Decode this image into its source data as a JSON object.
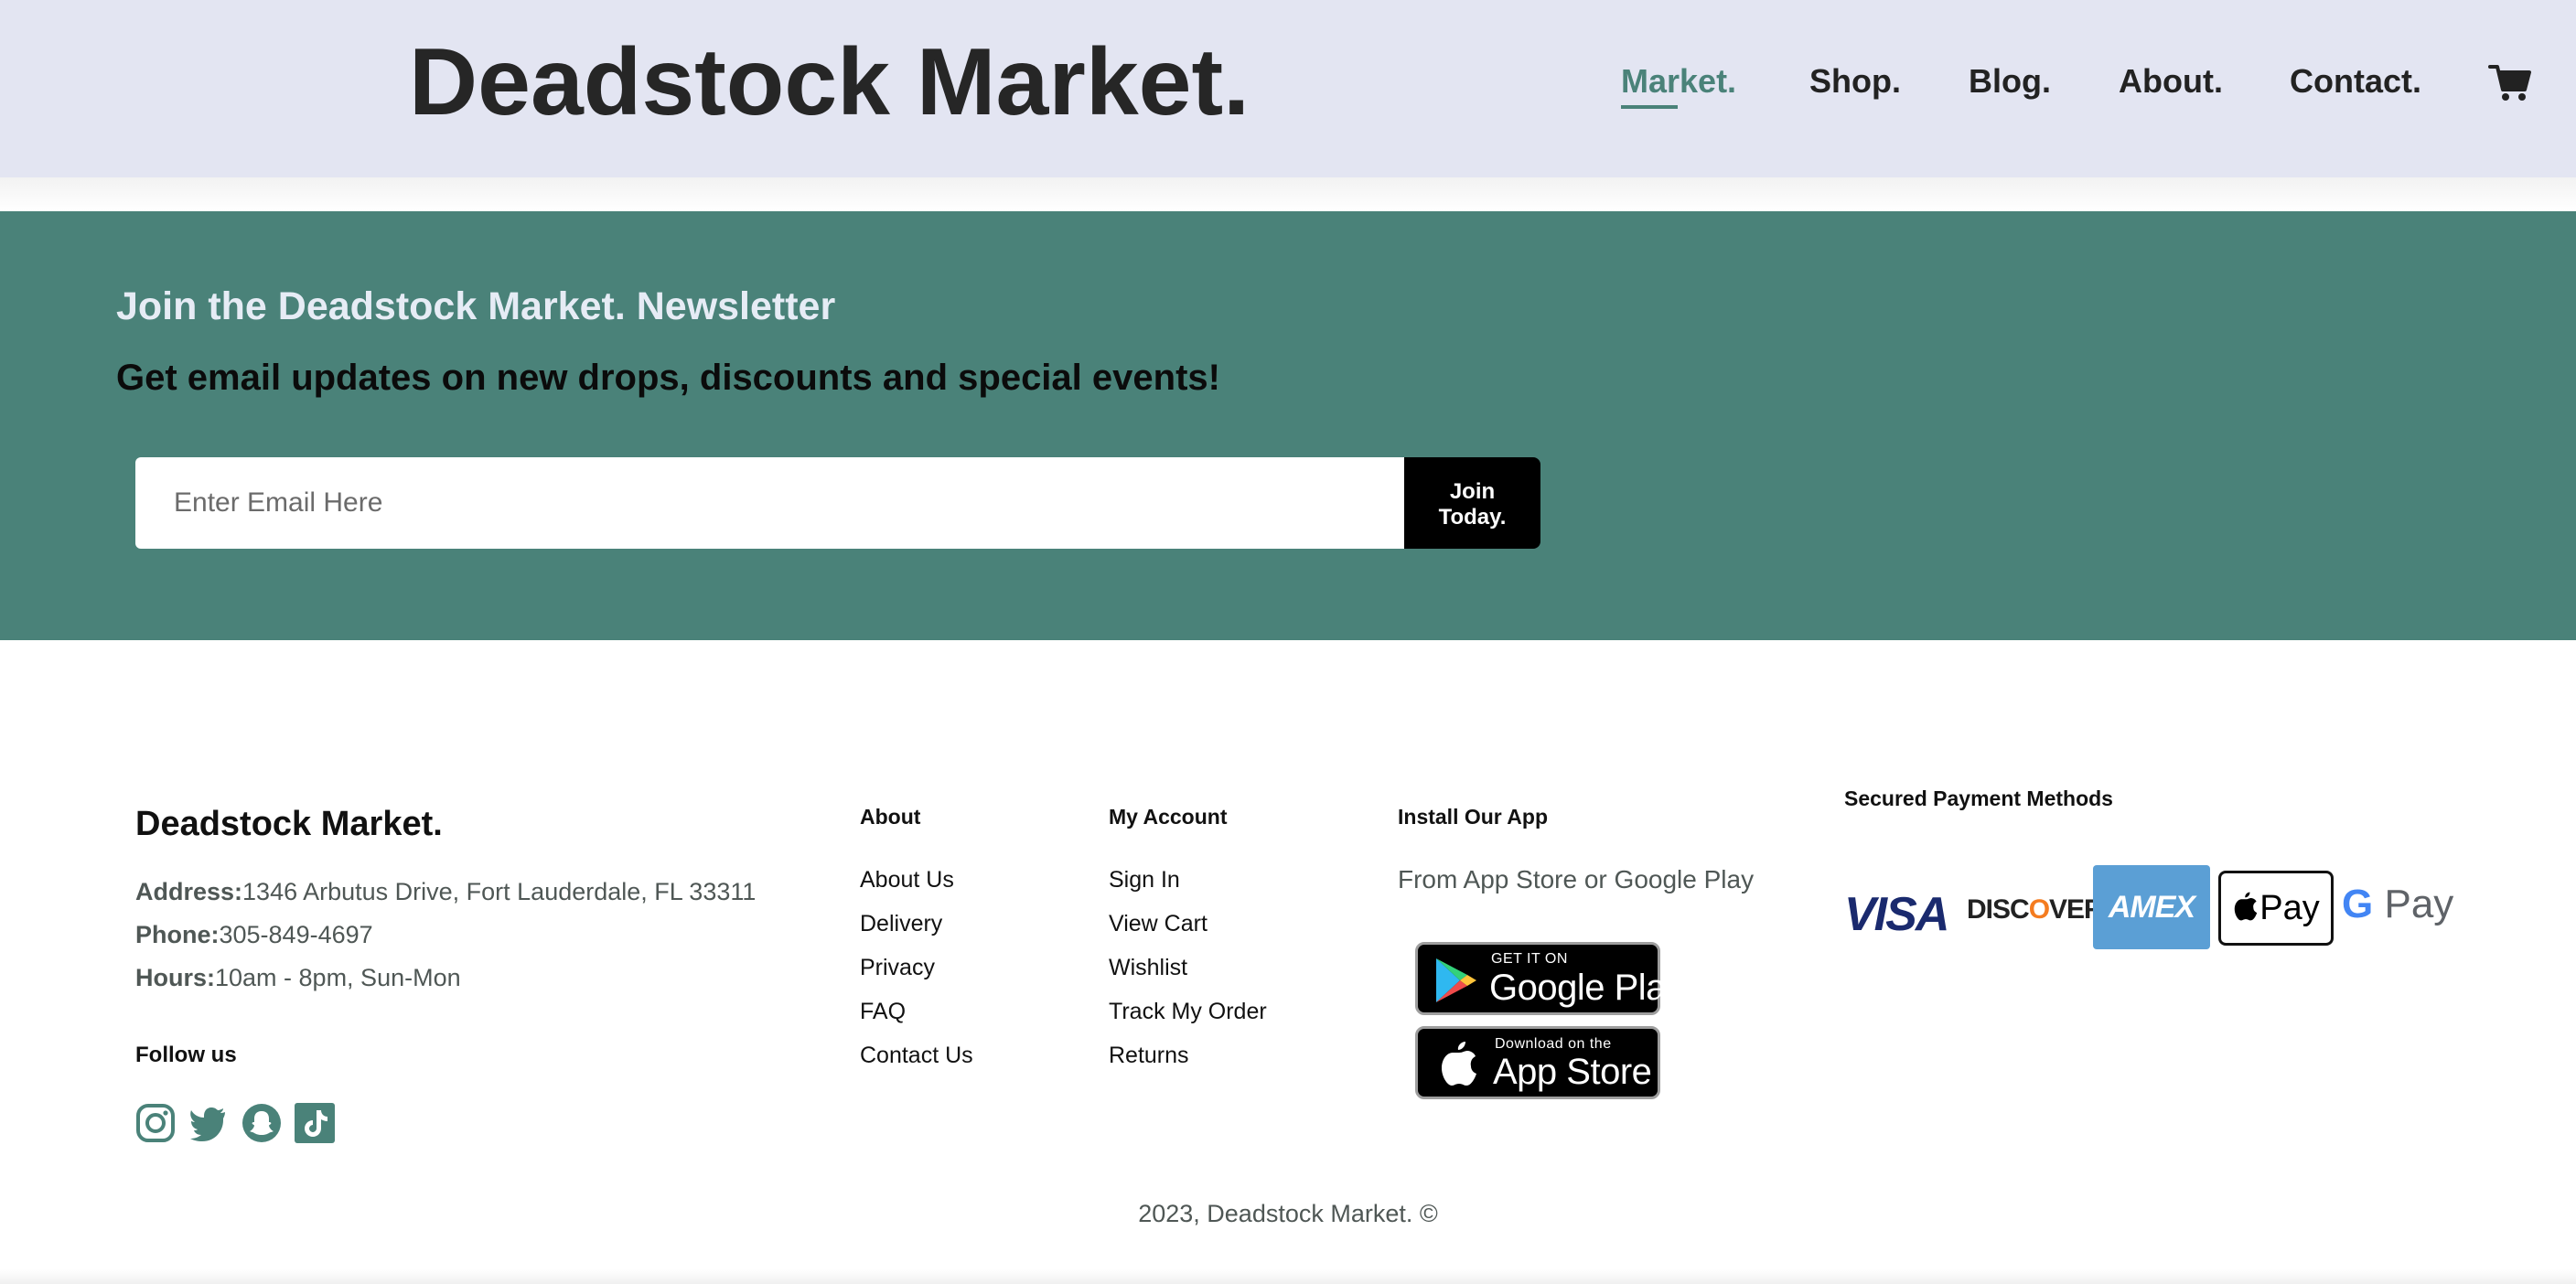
{
  "header": {
    "brand": "Deadstock Market.",
    "nav": [
      {
        "label": "Market.",
        "active": true
      },
      {
        "label": "Shop.",
        "active": false
      },
      {
        "label": "Blog.",
        "active": false
      },
      {
        "label": "About.",
        "active": false
      },
      {
        "label": "Contact.",
        "active": false
      }
    ],
    "cart_icon": "cart-icon"
  },
  "newsletter": {
    "title": "Join the Deadstock Market. Newsletter",
    "subtitle": "Get email updates on new drops, discounts and special events!",
    "email_placeholder": "Enter Email Here",
    "email_value": "",
    "button_label": "Join\nToday."
  },
  "footer": {
    "brand": "Deadstock Market.",
    "address_label": "Address:",
    "address": "1346 Arbutus Drive, Fort Lauderdale, FL 33311",
    "phone_label": "Phone:",
    "phone": "305-849-4697",
    "hours_label": "Hours:",
    "hours": "10am - 8pm, Sun-Mon",
    "follow_label": "Follow us",
    "social_icons": [
      "instagram-icon",
      "twitter-icon",
      "snapchat-icon",
      "tiktok-icon"
    ],
    "about": {
      "title": "About",
      "links": [
        "About Us",
        "Delivery",
        "Privacy",
        "FAQ",
        "Contact Us"
      ]
    },
    "account": {
      "title": "My Account",
      "links": [
        "Sign In",
        "View Cart",
        "Wishlist",
        "Track My Order",
        "Returns"
      ]
    },
    "app": {
      "title": "Install Our App",
      "text": "From App Store or Google Play",
      "google_small": "GET IT ON",
      "google_big": "Google Play",
      "apple_small": "Download on the",
      "apple_big": "App Store"
    },
    "payments": {
      "title": "Secured Payment Methods",
      "visa": "VISA",
      "discover_pre": "DISC",
      "discover_o": "O",
      "discover_post": "VER",
      "amex": "AMEX",
      "apple_pay": "Pay",
      "google_pay_g": "G",
      "google_pay": "Pay"
    },
    "copyright": "2023, Deadstock Market. ©"
  },
  "colors": {
    "header_bg": "#e3e5f2",
    "accent": "#4a8279",
    "newsletter_title": "#e6ecf5"
  }
}
